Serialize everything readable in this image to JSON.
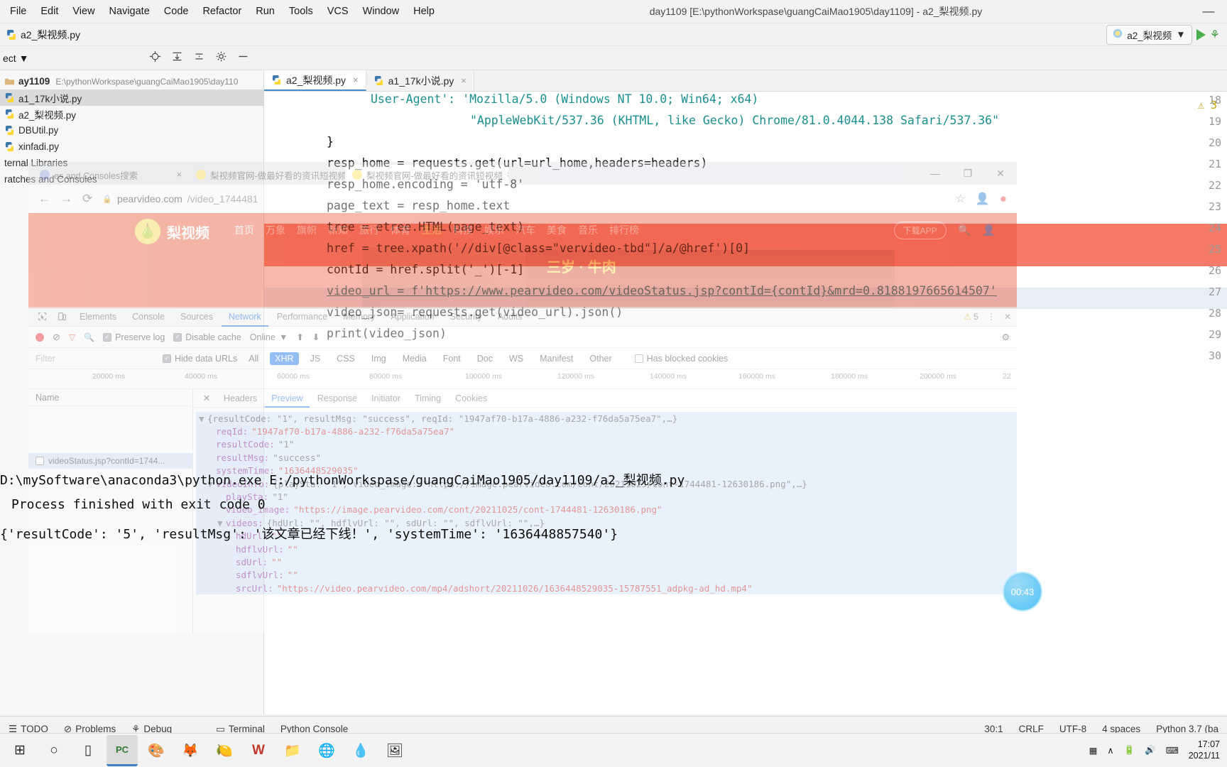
{
  "ide": {
    "menu": [
      "File",
      "Edit",
      "View",
      "Navigate",
      "Code",
      "Refactor",
      "Run",
      "Tools",
      "VCS",
      "Window",
      "Help"
    ],
    "window_title": "day1109 [E:\\pythonWorkspase\\guangCaiMao1905\\day1109] - a2_梨视频.py",
    "minimize": "—",
    "breadcrumb_file": "a2_梨视频.py",
    "run_config": "a2_梨视频",
    "run_dropdown_caret": "▼",
    "project_label": "ect",
    "project_caret": "▼",
    "tree": [
      {
        "label": "ay1109",
        "sub": "E:\\pythonWorkspase\\guangCaiMao1905\\day110",
        "bold": true,
        "selected": false
      },
      {
        "label": "a1_17k小说.py",
        "sub": "",
        "bold": false,
        "selected": true
      },
      {
        "label": "a2_梨视频.py",
        "sub": "",
        "bold": false,
        "selected": false
      },
      {
        "label": "DBUtil.py",
        "sub": "",
        "bold": false,
        "selected": false
      },
      {
        "label": "xinfadi.py",
        "sub": "",
        "bold": false,
        "selected": false
      },
      {
        "label": "ternal Libraries",
        "sub": "",
        "bold": false,
        "selected": false
      },
      {
        "label": "ratches and Consoles",
        "sub": "",
        "bold": false,
        "selected": false
      }
    ],
    "editor_tabs": [
      {
        "label": "a2_梨视频.py",
        "active": true,
        "close": "×"
      },
      {
        "label": "a1_17k小说.py",
        "active": false,
        "close": "×"
      }
    ],
    "warning_badge": "3",
    "code_lines": [
      {
        "num": "18",
        "text": "User-Agent': 'Mozilla/5.0 (Windows NT 10.0; Win64; x64)"
      },
      {
        "num": "19",
        "text": "\"AppleWebKit/537.36 (KHTML, like Gecko) Chrome/81.0.4044.138 Safari/537.36\""
      },
      {
        "num": "20",
        "text": "}"
      },
      {
        "num": "21",
        "text": "resp_home = requests.get(url=url_home,headers=headers)"
      },
      {
        "num": "22",
        "text": "resp_home.encoding = 'utf-8'"
      },
      {
        "num": "23",
        "text": "page_text = resp_home.text"
      },
      {
        "num": "24",
        "text": "tree = etree.HTML(page_text)"
      },
      {
        "num": "25",
        "text": "href = tree.xpath('//div[@class=\"vervideo-tbd\"]/a/@href')[0]"
      },
      {
        "num": "26",
        "text": "contId = href.split('_')[-1]"
      },
      {
        "num": "27",
        "text": "video_url = f'https://www.pearvideo.com/videoStatus.jsp?contId={contId}&mrd=0.8188197665614507'"
      },
      {
        "num": "28",
        "text": "video_json= requests.get(video_url).json()"
      },
      {
        "num": "29",
        "text": "print(video_json)"
      },
      {
        "num": "30",
        "text": ""
      }
    ],
    "console_output": [
      "D:\\mySoftware\\anaconda3\\python.exe E:/pythonWorkspase/guangCaiMao1905/day1109/a2_梨视频.py",
      "{'resultCode': '5', 'resultMsg': '该文章已经下线！', 'systemTime': '1636448857540'}"
    ],
    "process_line": "Process finished with exit code 0",
    "status_left": [
      "TODO",
      "Problems",
      "Debug",
      "Terminal",
      "Python Console"
    ],
    "status_right": [
      "30:1",
      "CRLF",
      "UTF-8",
      "4 spaces",
      "Python 3.7 (ba"
    ]
  },
  "browser": {
    "tabs": [
      {
        "title": "es and Consoles搜索",
        "selected": false,
        "close": "×"
      },
      {
        "title": "梨视频官网-做最好看的资讯短视频",
        "selected": false,
        "close": "×"
      },
      {
        "title": "梨视频官网-做最好看的资讯短视频",
        "selected": true,
        "close": "×"
      }
    ],
    "window_buttons": [
      "—",
      "❐",
      "✕"
    ],
    "nav": {
      "back": "←",
      "forward": "→",
      "reload": "⟳",
      "lock": "🔒"
    },
    "url_domain": "pearvideo.com",
    "url_path": "/video_1744481",
    "star": "☆",
    "profile": "👤",
    "menu": "⋮"
  },
  "pearvideo": {
    "logo": "梨视频",
    "logo_glyph": "🍐",
    "nav": [
      "首页",
      "万象",
      "旗帜",
      "新知",
      "旅行",
      "体育",
      "生活",
      "科技",
      "娱乐",
      "汽车",
      "美食",
      "音乐",
      "排行榜"
    ],
    "active_nav": "生活",
    "download_app": "下载APP",
    "search_icon": "🔍",
    "user_icon": "👤",
    "ad_text": "三岁 · 牛肉"
  },
  "devtools": {
    "panels": [
      "Elements",
      "Console",
      "Sources",
      "Network",
      "Performance",
      "Memory",
      "Application",
      "Security",
      "Audits"
    ],
    "active_panel": "Network",
    "warning_count": "5",
    "menu": "⋮",
    "close": "✕",
    "toolbar": {
      "preserve_log": "Preserve log",
      "disable_cache": "Disable cache",
      "throttling": "Online",
      "throttling_caret": "▼",
      "settings_icon": "⚙"
    },
    "filter": {
      "placeholder": "Filter",
      "hide_data_urls": "Hide data URLs",
      "types": [
        "All",
        "XHR",
        "JS",
        "CSS",
        "Img",
        "Media",
        "Font",
        "Doc",
        "WS",
        "Manifest",
        "Other"
      ],
      "active_type": "XHR",
      "has_blocked_cookies": "Has blocked cookies"
    },
    "timeline_ticks": [
      "20000 ms",
      "40000 ms",
      "60000 ms",
      "80000 ms",
      "100000 ms",
      "120000 ms",
      "140000 ms",
      "160000 ms",
      "180000 ms",
      "200000 ms",
      "22"
    ],
    "names_header": "Name",
    "requests": [
      {
        "name": "videoStatus.jsp?contId=1744..."
      }
    ],
    "subtabs": [
      "Headers",
      "Preview",
      "Response",
      "Initiator",
      "Timing",
      "Cookies"
    ],
    "active_subtab": "Preview",
    "subtab_close": "✕",
    "preview": [
      {
        "indent": 0,
        "arrow": "▼",
        "text": "{resultCode: \"1\", resultMsg: \"success\", reqId: \"1947af70-b17a-4886-a232-f76da5a75ea7\",…}",
        "sel": true
      },
      {
        "indent": 1,
        "arrow": "",
        "key": "reqId:",
        "value": "\"1947af70-b17a-4886-a232-f76da5a75ea7\"",
        "sel": true
      },
      {
        "indent": 1,
        "arrow": "",
        "key": "resultCode:",
        "value": "\"1\"",
        "sel": true
      },
      {
        "indent": 1,
        "arrow": "",
        "key": "resultMsg:",
        "value": "\"success\"",
        "sel": true
      },
      {
        "indent": 1,
        "arrow": "",
        "key": "systemTime:",
        "value": "\"1636448529035\"",
        "sel": true
      },
      {
        "indent": 1,
        "arrow": "▼",
        "key": "videoInfo:",
        "value": "{playSta: \"1\", video_image: \"https://image.pearvideo.com/cont/20211025/cont-1744481-12630186.png\",…}",
        "sel": true
      },
      {
        "indent": 2,
        "arrow": "",
        "key": "playSta:",
        "value": "\"1\"",
        "sel": true
      },
      {
        "indent": 2,
        "arrow": "",
        "key": "video_image:",
        "value": "\"https://image.pearvideo.com/cont/20211025/cont-1744481-12630186.png\"",
        "sel": true
      },
      {
        "indent": 2,
        "arrow": "▼",
        "key": "videos:",
        "value": "{hdUrl: \"\", hdflvUrl: \"\", sdUrl: \"\", sdflvUrl: \"\",…}",
        "sel": true
      },
      {
        "indent": 3,
        "arrow": "",
        "key": "hdUrl:",
        "value": "\"\"",
        "sel": true
      },
      {
        "indent": 3,
        "arrow": "",
        "key": "hdflvUrl:",
        "value": "\"\"",
        "sel": true
      },
      {
        "indent": 3,
        "arrow": "",
        "key": "sdUrl:",
        "value": "\"\"",
        "sel": true
      },
      {
        "indent": 3,
        "arrow": "",
        "key": "sdflvUrl:",
        "value": "\"\"",
        "sel": true
      },
      {
        "indent": 3,
        "arrow": "",
        "key": "srcUrl:",
        "value": "\"https://video.pearvideo.com/mp4/adshort/20211026/1636448529035-15787551_adpkg-ad_hd.mp4\"",
        "sel": true
      }
    ]
  },
  "timer_bubble": "00:43",
  "taskbar": {
    "start": "⊞",
    "search": "○",
    "taskview": "▯",
    "apps": [
      "PC",
      "🎨",
      "🦊",
      "🍋",
      "W",
      "📁",
      "🌐",
      "💧",
      "🖼"
    ],
    "active_app": "PC",
    "tray": [
      "▦",
      "∧",
      "🔋",
      "🔊",
      "⌨"
    ],
    "time": "17:07",
    "date": "2021/11"
  }
}
